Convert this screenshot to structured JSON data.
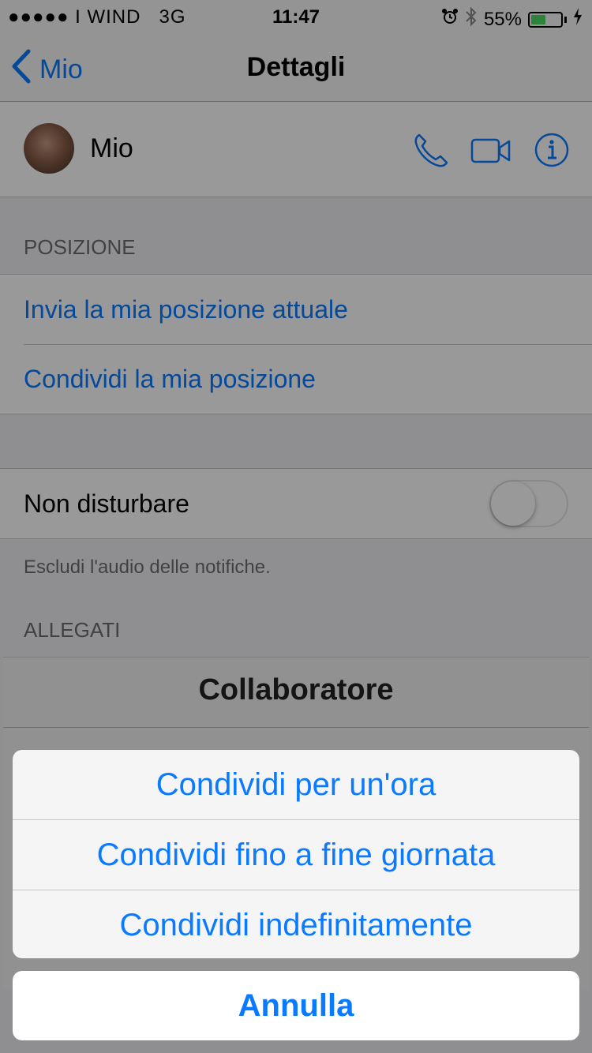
{
  "status_bar": {
    "signal": "●●●●● I WIND",
    "network": "3G",
    "time": "11:47",
    "battery_percent": "55%",
    "battery_level": 0.55,
    "icons": [
      "alarm-icon",
      "bluetooth-icon",
      "battery-icon",
      "charging-icon"
    ]
  },
  "navbar": {
    "back_label": "Mio",
    "title": "Dettagli"
  },
  "contact": {
    "name": "Mio",
    "actions": [
      "phone-icon",
      "video-icon",
      "info-icon"
    ]
  },
  "location": {
    "header": "POSIZIONE",
    "items": [
      "Invia la mia posizione attuale",
      "Condividi la mia posizione"
    ]
  },
  "dnd": {
    "label": "Non disturbare",
    "enabled": false,
    "note": "Escludi l'audio delle notifiche."
  },
  "attachments": {
    "header": "ALLEGATI"
  },
  "background_card": {
    "title": "Collaboratore"
  },
  "action_sheet": {
    "options": [
      "Condividi per un'ora",
      "Condividi fino a fine giornata",
      "Condividi indefinitamente"
    ],
    "cancel": "Annulla"
  },
  "colors": {
    "accent": "#0a7aff",
    "battery": "#4cd964"
  }
}
